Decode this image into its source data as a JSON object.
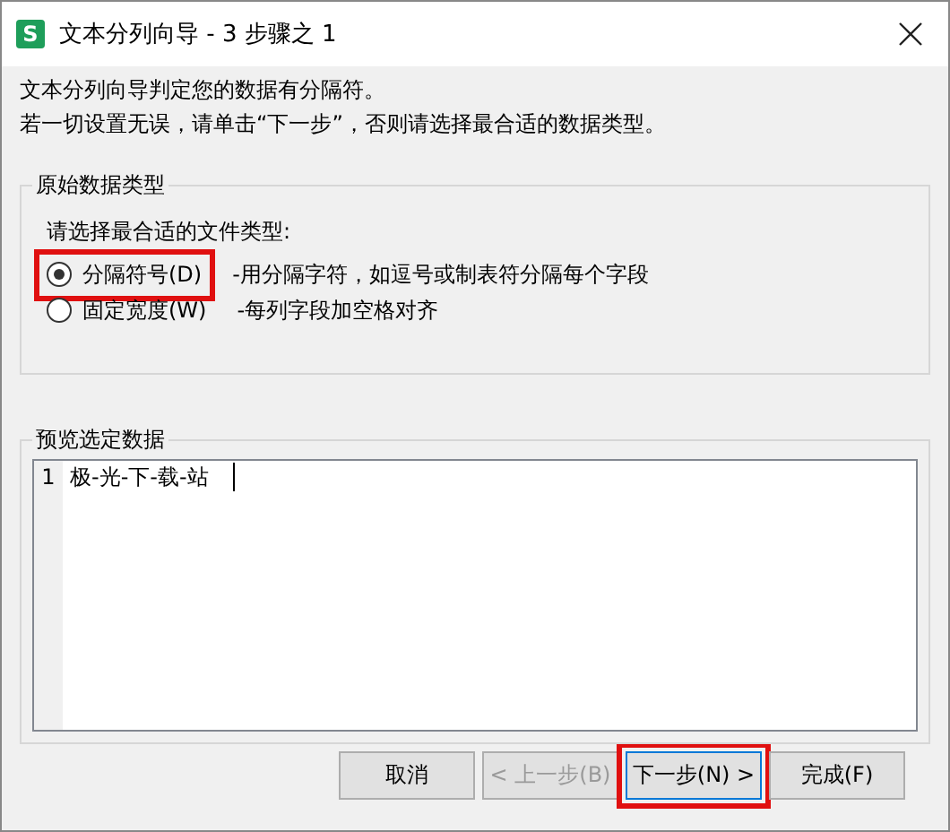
{
  "window": {
    "title": "文本分列向导 - 3 步骤之 1",
    "app_icon": "S"
  },
  "intro": [
    "文本分列向导判定您的数据有分隔符。",
    "若一切设置无误，请单击“下一步”，否则请选择最合适的数据类型。"
  ],
  "original_type": {
    "legend": "原始数据类型",
    "prompt": "请选择最合适的文件类型:",
    "options": [
      {
        "label": "分隔符号(D)",
        "description": "-用分隔字符，如逗号或制表符分隔每个字段",
        "selected": true,
        "highlighted": true
      },
      {
        "label": "固定宽度(W)",
        "description": "-每列字段加空格对齐",
        "selected": false,
        "highlighted": false
      }
    ]
  },
  "preview": {
    "legend": "预览选定数据",
    "rows": [
      {
        "number": "1",
        "text": "极-光-下-载-站"
      }
    ]
  },
  "buttons": [
    {
      "label": "取消",
      "disabled": false,
      "focused": false,
      "highlighted": false
    },
    {
      "label": "< 上一步(B)",
      "disabled": true,
      "focused": false,
      "highlighted": false
    },
    {
      "label": "下一步(N) >",
      "disabled": false,
      "focused": true,
      "highlighted": true
    },
    {
      "label": "完成(F)",
      "disabled": false,
      "focused": false,
      "highlighted": false
    }
  ]
}
